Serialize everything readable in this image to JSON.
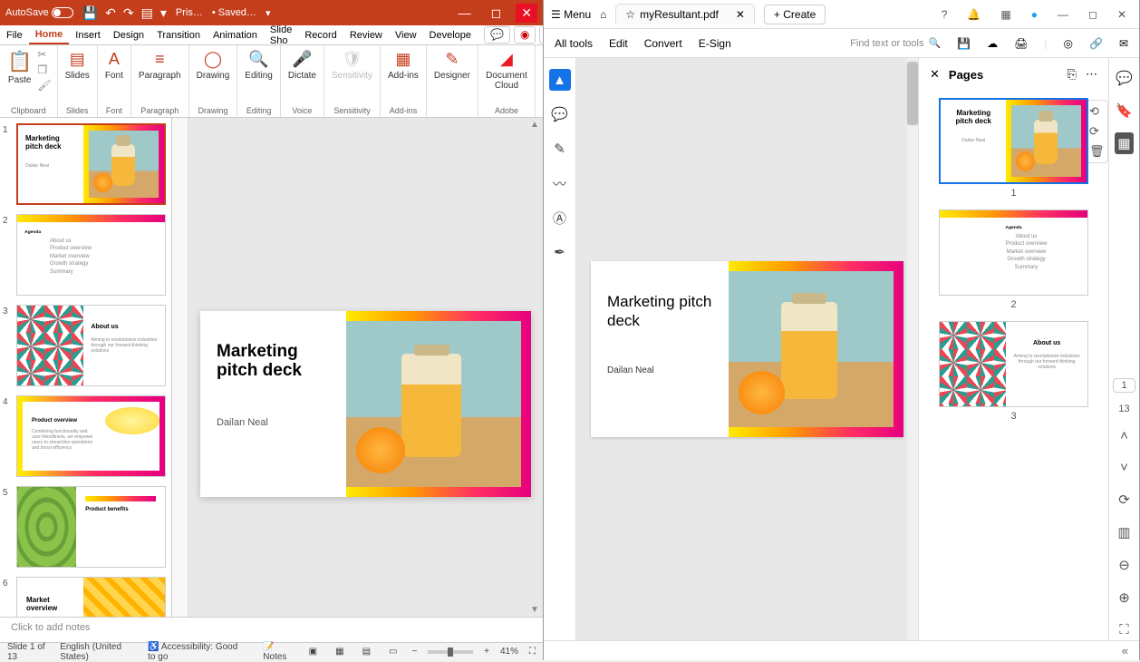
{
  "pp": {
    "autosave": "AutoSave",
    "docname": "Pris…",
    "savedLabel": "• Saved…",
    "tabs": [
      "File",
      "Home",
      "Insert",
      "Design",
      "Transition",
      "Animation",
      "Slide Sho",
      "Record",
      "Review",
      "View",
      "Develope"
    ],
    "activeTab": "Home",
    "ribbon": {
      "clipboard": {
        "label": "Clipboard",
        "paste": "Paste"
      },
      "slides": {
        "label": "Slides",
        "btn": "Slides"
      },
      "font": {
        "label": "Font",
        "btn": "Font"
      },
      "paragraph": {
        "label": "Paragraph",
        "btn": "Paragraph"
      },
      "drawing": {
        "label": "Drawing",
        "btn": "Drawing"
      },
      "editing": {
        "label": "Editing",
        "btn": "Editing"
      },
      "voice": {
        "label": "Voice",
        "btn": "Dictate"
      },
      "sensitivity": {
        "label": "Sensitivity",
        "btn": "Sensitivity"
      },
      "addins": {
        "label": "Add-ins",
        "btn": "Add-ins"
      },
      "designer": {
        "btn": "Designer"
      },
      "adobe": {
        "label": "Adobe",
        "btn": "Document Cloud"
      }
    },
    "slides": [
      {
        "num": "1",
        "kind": "pitch",
        "title": "Marketing pitch deck",
        "author": "Dailan Neal"
      },
      {
        "num": "2",
        "kind": "agenda",
        "title": "Agenda",
        "items": [
          "About us",
          "Product overview",
          "Market overview",
          "Growth strategy",
          "Summary"
        ]
      },
      {
        "num": "3",
        "kind": "about",
        "title": "About us",
        "sub": "Aiming to revolutionize industries through our forward-thinking solutions"
      },
      {
        "num": "4",
        "kind": "po",
        "title": "Product overview",
        "sub": "Combining functionality and user-friendliness, we empower users to streamline operations and boost efficiency"
      },
      {
        "num": "5",
        "kind": "pb",
        "title": "Product benefits"
      },
      {
        "num": "6",
        "kind": "mo",
        "title": "Market overview"
      }
    ],
    "mainSlide": {
      "title": "Marketing pitch deck",
      "author": "Dailan Neal"
    },
    "notesPlaceholder": "Click to add notes",
    "status": {
      "slide": "Slide 1 of 13",
      "lang": "English (United States)",
      "access": "Accessibility: Good to go",
      "notes": "Notes",
      "zoom": "41%"
    }
  },
  "ac": {
    "menu": "Menu",
    "tabTitle": "myResultant.pdf",
    "create": "Create",
    "toolbar": [
      "All tools",
      "Edit",
      "Convert",
      "E-Sign"
    ],
    "search": "Find text or tools",
    "pagesTitle": "Pages",
    "pdfMain": {
      "title": "Marketing pitch deck",
      "author": "Dailan Neal"
    },
    "pageThumbs": [
      {
        "n": "1",
        "kind": "pitch",
        "title": "Marketing pitch deck",
        "author": "Dailan Neal"
      },
      {
        "n": "2",
        "kind": "agenda",
        "title": "Agenda",
        "items": [
          "About us",
          "Product overview",
          "Market overview",
          "Growth strategy",
          "Summary"
        ]
      },
      {
        "n": "3",
        "kind": "about",
        "title": "About us",
        "sub": "Aiming to revolutionize industries through our forward-thinking solutions"
      }
    ],
    "totalPages": "13",
    "currentPage": "1"
  }
}
